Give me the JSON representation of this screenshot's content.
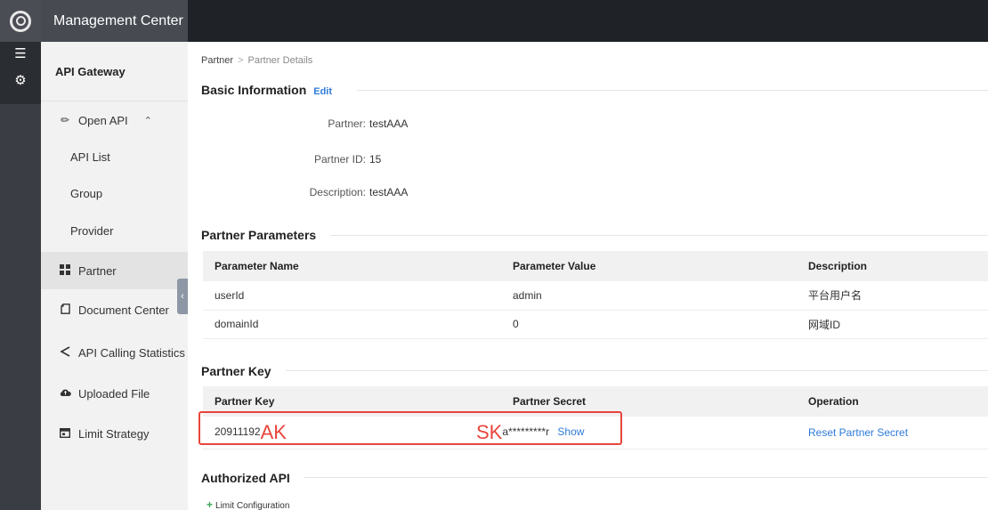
{
  "app": {
    "title": "Management Center"
  },
  "sidebar": {
    "header": "API Gateway",
    "open_api": {
      "label": "Open API",
      "icon": "pencil-icon"
    },
    "sub_items": [
      "API List",
      "Group",
      "Provider"
    ],
    "items": [
      {
        "label": "Partner",
        "icon": "grid-icon",
        "active": true
      },
      {
        "label": "Document Center",
        "icon": "document-icon"
      },
      {
        "label": "API Calling Statistics",
        "icon": "share-icon"
      },
      {
        "label": "Uploaded File",
        "icon": "cloud-upload-icon"
      },
      {
        "label": "Limit Strategy",
        "icon": "calendar-icon"
      }
    ]
  },
  "breadcrumb": {
    "parent": "Partner",
    "separator": ">",
    "current": "Partner Details"
  },
  "basic_info": {
    "title": "Basic Information",
    "edit": "Edit",
    "fields": [
      {
        "label": "Partner:",
        "value": "testAAA"
      },
      {
        "label": "Partner ID:",
        "value": "15"
      },
      {
        "label": "Description:",
        "value": "testAAA"
      }
    ]
  },
  "partner_params": {
    "title": "Partner Parameters",
    "columns": [
      "Parameter Name",
      "Parameter Value",
      "Description"
    ],
    "rows": [
      [
        "userId",
        "admin",
        "平台用户名"
      ],
      [
        "domainId",
        "0",
        "网域ID"
      ]
    ]
  },
  "partner_key": {
    "title": "Partner Key",
    "columns": [
      "Partner Key",
      "Partner Secret",
      "Operation"
    ],
    "key": "20911192",
    "ak_annotation": "AK",
    "sk_annotation": "SK",
    "secret_masked": "a*********r",
    "show": "Show",
    "operation": "Reset Partner Secret"
  },
  "authorized_api": {
    "title": "Authorized API",
    "limit_config": "Limit Configuration"
  },
  "colors": {
    "accent": "#2f7bd9",
    "annotation": "#e8453c",
    "topbar": "#1f2226",
    "sidebar": "#f2f2f2"
  }
}
